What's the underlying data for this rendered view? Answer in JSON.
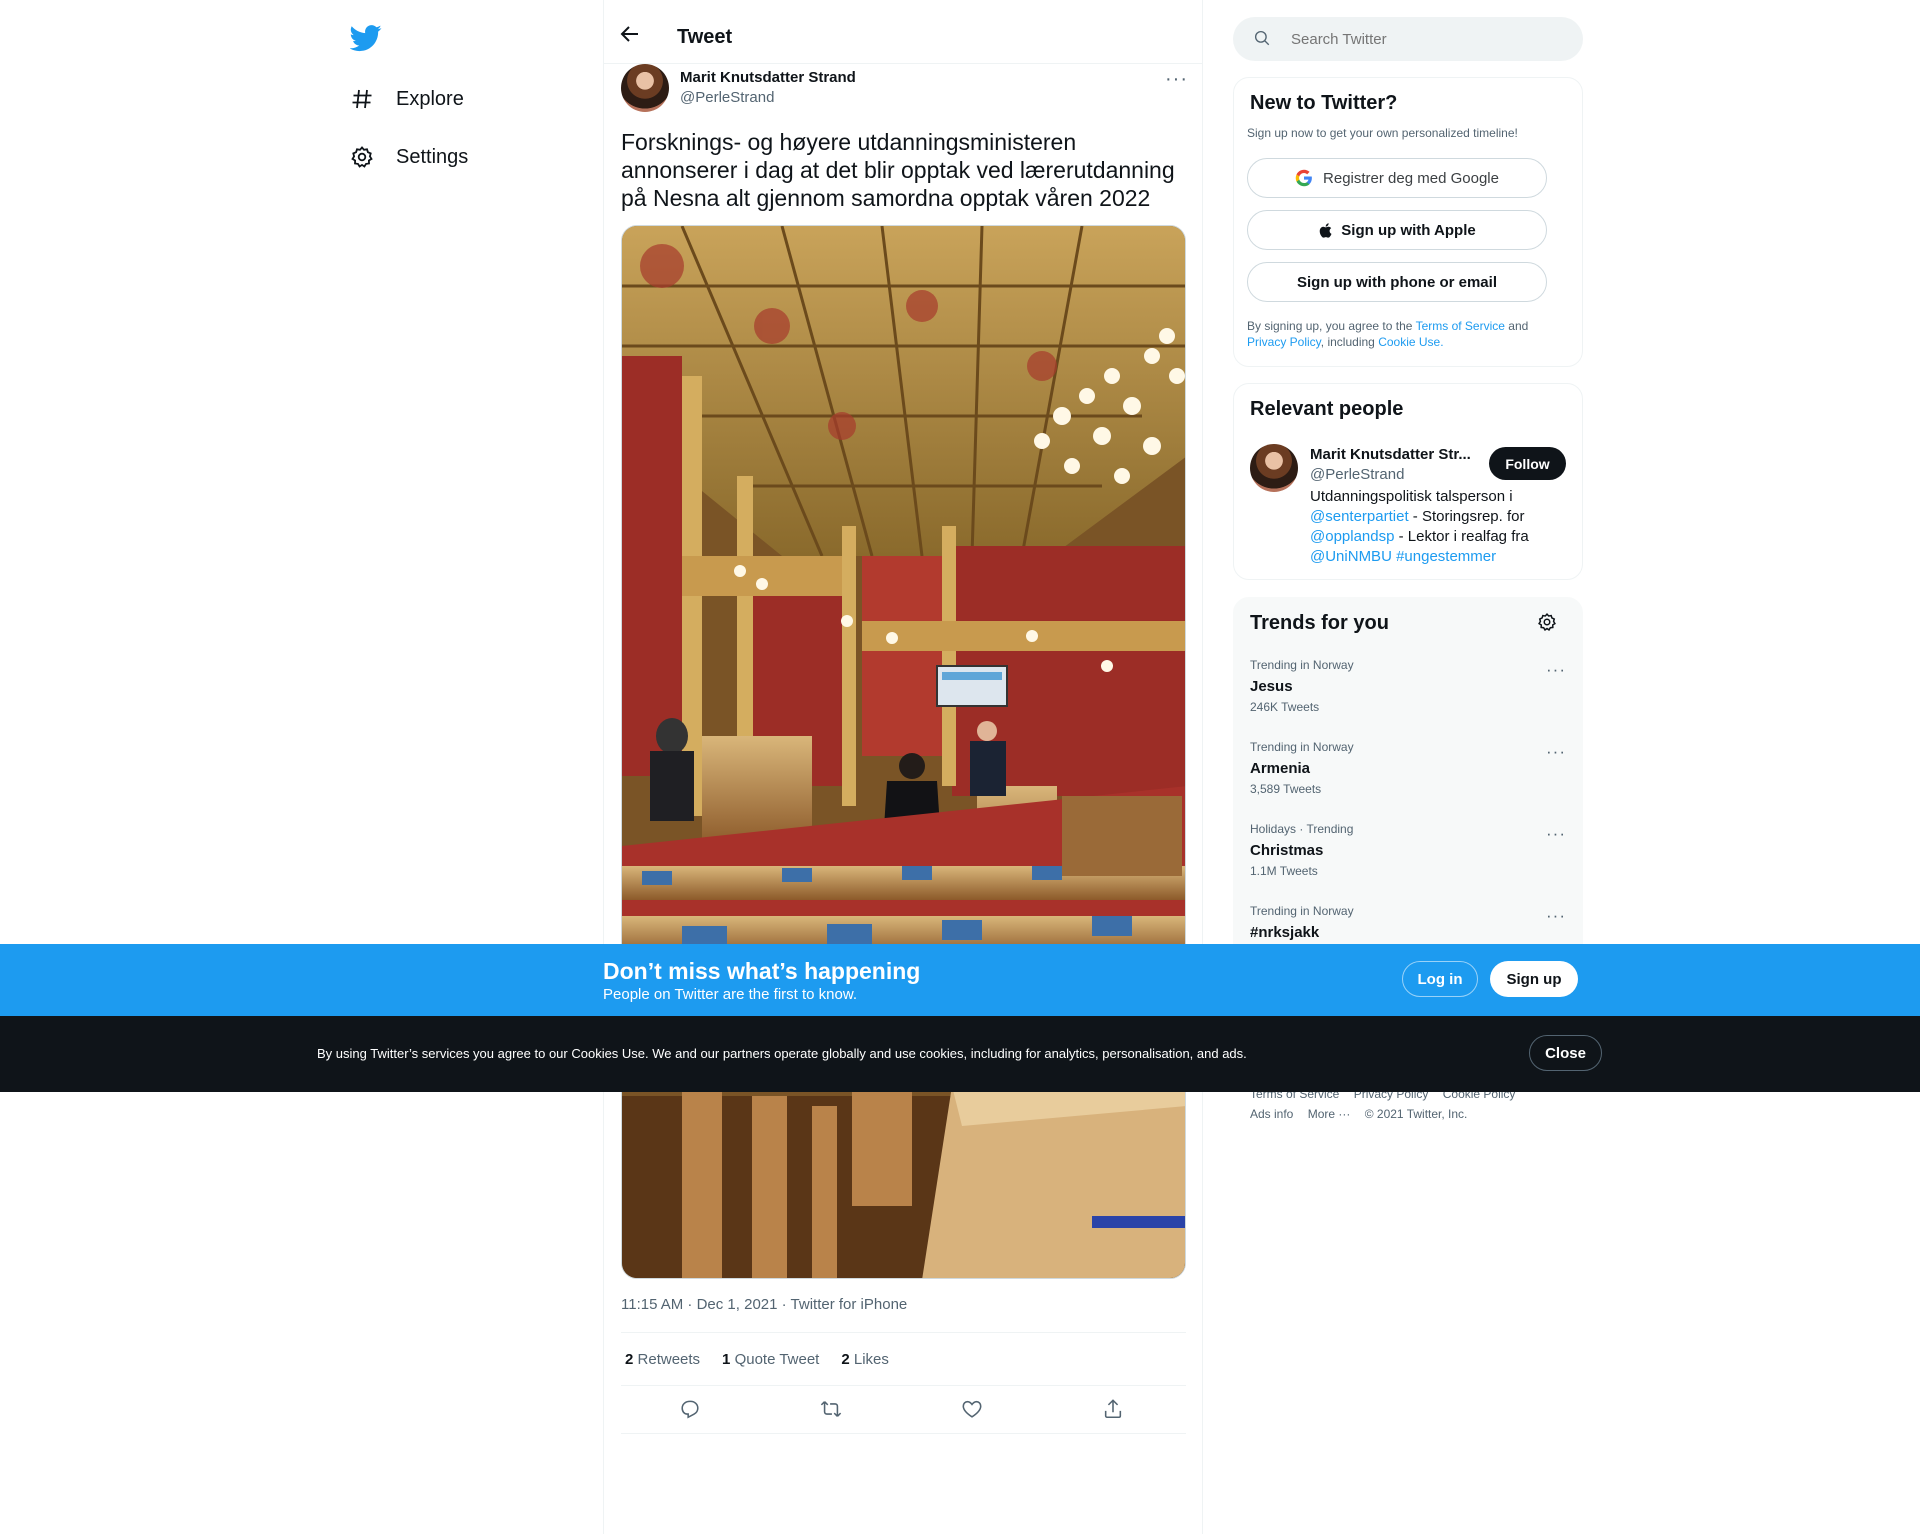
{
  "nav": {
    "logo_icon": "twitter-bird-icon",
    "items": [
      {
        "label": "Explore",
        "icon": "hashtag-icon"
      },
      {
        "label": "Settings",
        "icon": "gear-icon"
      }
    ]
  },
  "header": {
    "title": "Tweet",
    "back_icon": "arrow-left-icon"
  },
  "tweet": {
    "author_name": "Marit Knutsdatter Strand",
    "author_handle": "@PerleStrand",
    "more_label": "···",
    "text": "Forsknings- og høyere utdanningsministeren annonserer i dag at det blir opptak ved lærerutdanning på Nesna alt gjennom samordna opptak våren 2022",
    "timestamp": "11:15 AM · Dec 1, 2021 · Twitter for iPhone",
    "stats": {
      "retweets_count": "2",
      "retweets_label": "Retweets",
      "quotes_count": "1",
      "quotes_label": "Quote Tweet",
      "likes_count": "2",
      "likes_label": "Likes"
    },
    "actions": [
      "reply-icon",
      "retweet-icon",
      "like-icon",
      "share-icon"
    ]
  },
  "search": {
    "placeholder": "Search Twitter"
  },
  "signup_card": {
    "title": "New to Twitter?",
    "subtitle": "Sign up now to get your own personalized timeline!",
    "google_label": "Registrer deg med Google",
    "apple_label": "Sign up with Apple",
    "phone_label": "Sign up with phone or email",
    "legal_prefix": "By signing up, you agree to the",
    "terms": "Terms of Service",
    "and": "and",
    "privacy": "Privacy Policy",
    "including": ", including",
    "cookie": "Cookie Use."
  },
  "relevant": {
    "title": "Relevant people",
    "name": "Marit Knutsdatter Str...",
    "handle": "@PerleStrand",
    "follow_label": "Follow",
    "bio_1": "Utdanningspolitisk talsperson i",
    "bio_link_1": "@senterpartiet",
    "bio_2": " - Storingsrep. for",
    "bio_link_2": "@opplandsp",
    "bio_3": " - Lektor i realfag fra",
    "bio_link_3": "@UniNMBU",
    "bio_link_4": "#ungestemmer"
  },
  "trends": {
    "title": "Trends for you",
    "items": [
      {
        "context": "Trending in Norway",
        "name": "Jesus",
        "count": "246K Tweets"
      },
      {
        "context": "Trending in Norway",
        "name": "Armenia",
        "count": "3,589 Tweets"
      },
      {
        "context": "Holidays · Trending",
        "name": "Christmas",
        "count": "1.1M Tweets"
      },
      {
        "context": "Trending in Norway",
        "name": "#nrksjakk",
        "count": ""
      }
    ]
  },
  "footer": {
    "links_1": [
      "Terms of Service",
      "Privacy Policy",
      "Cookie Policy"
    ],
    "links_2": [
      "Ads info",
      "More ···",
      "© 2021 Twitter, Inc."
    ]
  },
  "banner": {
    "title": "Don’t miss what’s happening",
    "subtitle": "People on Twitter are the first to know.",
    "login_label": "Log in",
    "signup_label": "Sign up"
  },
  "cookie": {
    "text": "By using Twitter’s services you agree to our Cookies Use. We and our partners operate globally and use cookies, including for analytics, personalisation, and ads.",
    "close_label": "Close"
  },
  "colors": {
    "brand": "#1d9bf0",
    "text": "#0f1419",
    "muted": "#536471"
  }
}
